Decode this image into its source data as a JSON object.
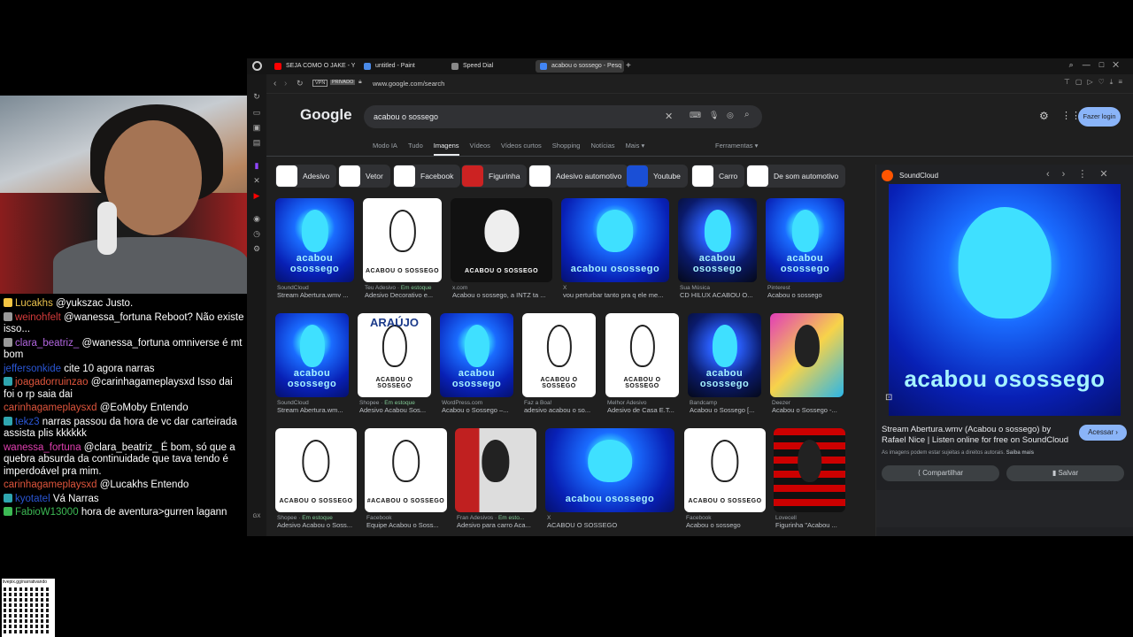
{
  "chat": [
    {
      "user": "Lucakhs",
      "color": "#e8c04c",
      "text": "@yukszac Justo.",
      "badge": "#f5c542"
    },
    {
      "user": "weinohfelt",
      "color": "#d63b3b",
      "text": "@wanessa_fortuna Reboot? Não existe isso...",
      "badge": "#999"
    },
    {
      "user": "clara_beatriz_",
      "color": "#b266e0",
      "text": "@wanessa_fortuna omniverse é mt bom",
      "badge": "#999"
    },
    {
      "user": "jeffersonkide",
      "color": "#2a56d4",
      "text": "cite 10 agora narras",
      "badge": ""
    },
    {
      "user": "joagadorruinzao",
      "color": "#e0553c",
      "text": "@carinhagameplaysxd Isso dai foi o rp saia dai",
      "badge": "#2fa6b0"
    },
    {
      "user": "carinhagameplaysxd",
      "color": "#e0553c",
      "text": "@EoMoby Entendo",
      "badge": ""
    },
    {
      "user": "tekz3",
      "color": "#2a56d4",
      "text": "narras passou da hora de vc dar carteirada assista plis kkkkkk",
      "badge": "#2fa6b0"
    },
    {
      "user": "wanessa_fortuna",
      "color": "#e03fb0",
      "text": "@clara_beatriz_ É bom, só que a quebra absurda da continuidade que tava tendo é imperdoável pra mim.",
      "badge": ""
    },
    {
      "user": "carinhagameplaysxd",
      "color": "#e0553c",
      "text": "@Lucakhs Entendo",
      "badge": ""
    },
    {
      "user": "kyotatel",
      "color": "#2a56d4",
      "text": "Vá Narras",
      "badge": "#2fa6b0"
    },
    {
      "user": "FabioW13000",
      "color": "#3cba54",
      "text": "hora de aventura>gurren lagann",
      "badge": "#3cba54"
    }
  ],
  "qr_label": "livepix.gg/narrativando",
  "tabs": [
    {
      "label": "SEJA COMO O JAKE - Yo",
      "icon": "#ff0000"
    },
    {
      "label": "untitled - Paint",
      "icon": "#4a8ae8"
    },
    {
      "label": "Speed Dial",
      "icon": "#888"
    },
    {
      "label": "acabou o sossego - Pesq",
      "icon": "#4285f4"
    }
  ],
  "address": {
    "vpn": "VPN",
    "private": "PRIVADO",
    "url": "www.google.com/search"
  },
  "google": {
    "logo": "Google",
    "query": "acabou o sossego",
    "login": "Fazer login",
    "nav": [
      "Modo IA",
      "Tudo",
      "Imagens",
      "Vídeos",
      "Vídeos curtos",
      "Shopping",
      "Notícias",
      "Mais ▾"
    ],
    "tools": "Ferramentas ▾"
  },
  "chips": [
    "Adesivo",
    "Vetor",
    "Facebook",
    "Figurinha",
    "Adesivo automotivo",
    "Youtube",
    "Carro",
    "De som automotivo"
  ],
  "results": [
    {
      "src": "SoundCloud",
      "title": "Stream Abertura.wmv ...",
      "style": "blue",
      "stock": ""
    },
    {
      "src": "Teu Adesivo",
      "title": "Adesivo Decorativo e...",
      "style": "white",
      "stock": "Em estoque"
    },
    {
      "src": "x.com",
      "title": "Acabou o sossego, a INTZ ta ...",
      "style": "black",
      "stock": ""
    },
    {
      "src": "X",
      "title": "vou perturbar tanto pra q ele me...",
      "style": "blue",
      "stock": ""
    },
    {
      "src": "Sua Música",
      "title": "CD HILUX ACABOU O...",
      "style": "bluedark",
      "stock": ""
    },
    {
      "src": "Pinterest",
      "title": "Acabou o sossego",
      "style": "blue",
      "stock": ""
    },
    {
      "src": "SoundCloud",
      "title": "Stream Abertura.wm...",
      "style": "blue",
      "stock": ""
    },
    {
      "src": "Shopee",
      "title": "Adesivo Acabou Sos...",
      "style": "white",
      "stock": "Em estoque"
    },
    {
      "src": "WordPress.com",
      "title": "Acabou o Sossego –...",
      "style": "blue",
      "stock": ""
    },
    {
      "src": "Faz a Boa!",
      "title": "adesivo acabou o so...",
      "style": "white",
      "stock": ""
    },
    {
      "src": "Melhor Adesivo",
      "title": "Adesivo de Casa E.T...",
      "style": "white",
      "stock": ""
    },
    {
      "src": "Bandcamp",
      "title": "Acabou o Sossego [...",
      "style": "bluedark",
      "stock": ""
    },
    {
      "src": "Deezer",
      "title": "Acabou o Sossego -...",
      "style": "pink",
      "stock": ""
    },
    {
      "src": "Shopee",
      "title": "Adesivo Acabou o Soss...",
      "style": "white",
      "stock": "Em estoque"
    },
    {
      "src": "Facebook",
      "title": "Equipe Acabou o Soss...",
      "style": "white",
      "stock": ""
    },
    {
      "src": "Fran Adesivos",
      "title": "Adesivo para carro Aca...",
      "style": "red",
      "stock": "Em esto..."
    },
    {
      "src": "X",
      "title": "ACABOU O SOSSEGO",
      "style": "blue",
      "stock": ""
    },
    {
      "src": "Facebook",
      "title": "Acabou o sossego",
      "style": "white",
      "stock": ""
    },
    {
      "src": "Lovecell",
      "title": "Figurinha \"Acabou ...",
      "style": "flamengo",
      "stock": ""
    }
  ],
  "img_texts": {
    "acabou": "ACABOU O SOSSEGO",
    "blue": "acabou osossego",
    "araujo": "ARAÚJO",
    "equipe": "#ACABOU O SOSSEGO"
  },
  "panel": {
    "source": "SoundCloud",
    "title": "Stream Abertura.wmv (Acabou o sossego) by Rafael Nice | Listen online for free on SoundCloud",
    "visit": "Acessar ›",
    "notice": "As imagens podem estar sujeitas a direitos autorais.",
    "more": "Saiba mais",
    "share": "Compartilhar",
    "save": "Salvar"
  },
  "colors": {
    "accent": "#8ab4f8",
    "bg": "#1f1f1f"
  }
}
